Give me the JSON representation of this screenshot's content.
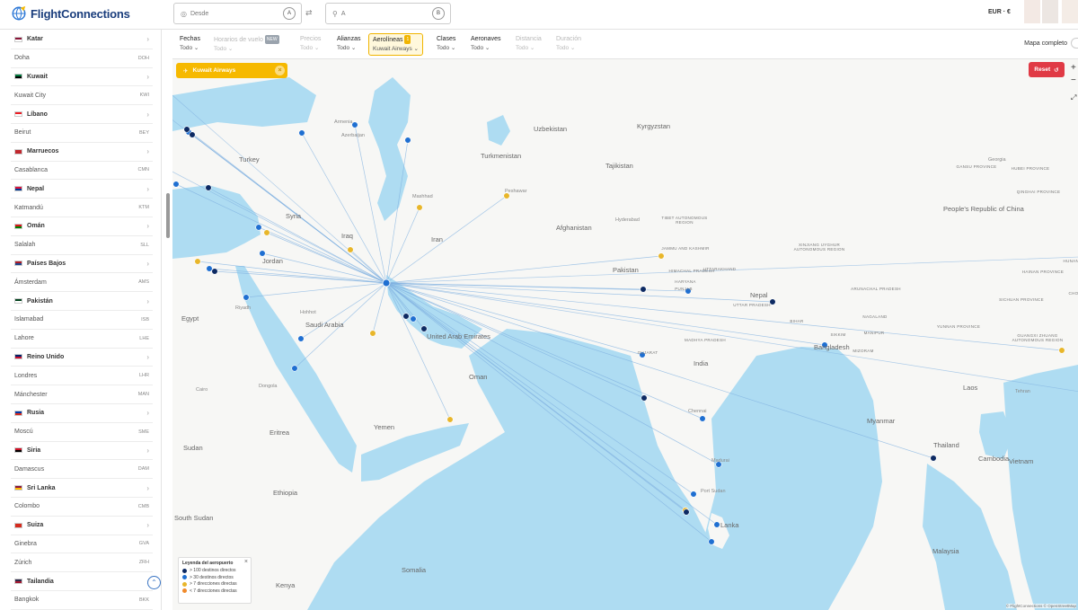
{
  "header": {
    "logo_text": "FlightConnections",
    "from_placeholder": "Desde",
    "from_badge": "A",
    "to_placeholder": "A",
    "to_badge": "B",
    "currency": "EUR · €"
  },
  "sidebar": {
    "rows": [
      {
        "type": "country",
        "name": "Katar",
        "flag": [
          "#8a1538",
          "#fff"
        ]
      },
      {
        "type": "city",
        "name": "Doha",
        "code": "DOH"
      },
      {
        "type": "country",
        "name": "Kuwait",
        "flag": [
          "#007a3d",
          "#000"
        ]
      },
      {
        "type": "city",
        "name": "Kuwait City",
        "code": "KWI"
      },
      {
        "type": "country",
        "name": "Líbano",
        "flag": [
          "#ed1c24",
          "#fff"
        ]
      },
      {
        "type": "city",
        "name": "Beirut",
        "code": "BEY"
      },
      {
        "type": "country",
        "name": "Marruecos",
        "flag": [
          "#c1272d",
          "#c1272d"
        ]
      },
      {
        "type": "city",
        "name": "Casablanca",
        "code": "CMN"
      },
      {
        "type": "country",
        "name": "Nepal",
        "flag": [
          "#dc143c",
          "#003893"
        ]
      },
      {
        "type": "city",
        "name": "Katmandú",
        "code": "KTM"
      },
      {
        "type": "country",
        "name": "Omán",
        "flag": [
          "#db161b",
          "#008000"
        ]
      },
      {
        "type": "city",
        "name": "Salalah",
        "code": "SLL"
      },
      {
        "type": "country",
        "name": "Países Bajos",
        "flag": [
          "#ae1c28",
          "#21468b"
        ]
      },
      {
        "type": "city",
        "name": "Ámsterdam",
        "code": "AMS"
      },
      {
        "type": "country",
        "name": "Pakistán",
        "flag": [
          "#01411c",
          "#fff"
        ]
      },
      {
        "type": "city",
        "name": "Islamabad",
        "code": "ISB"
      },
      {
        "type": "city",
        "name": "Lahore",
        "code": "LHE"
      },
      {
        "type": "country",
        "name": "Reino Unido",
        "flag": [
          "#012169",
          "#c8102e"
        ]
      },
      {
        "type": "city",
        "name": "Londres",
        "code": "LHR"
      },
      {
        "type": "city",
        "name": "Mánchester",
        "code": "MAN"
      },
      {
        "type": "country",
        "name": "Rusia",
        "flag": [
          "#0039a6",
          "#d52b1e"
        ]
      },
      {
        "type": "city",
        "name": "Moscú",
        "code": "SME"
      },
      {
        "type": "country",
        "name": "Siria",
        "flag": [
          "#ce1126",
          "#000"
        ]
      },
      {
        "type": "city",
        "name": "Damascus",
        "code": "DAM"
      },
      {
        "type": "country",
        "name": "Sri Lanka",
        "flag": [
          "#8d153a",
          "#ffb700"
        ]
      },
      {
        "type": "city",
        "name": "Colombo",
        "code": "CMB"
      },
      {
        "type": "country",
        "name": "Suiza",
        "flag": [
          "#d52b1e",
          "#d52b1e"
        ]
      },
      {
        "type": "city",
        "name": "Ginebra",
        "code": "GVA"
      },
      {
        "type": "city",
        "name": "Zúrich",
        "code": "ZRH"
      },
      {
        "type": "country",
        "name": "Tailandia",
        "flag": [
          "#2d2a4a",
          "#a51931"
        ]
      },
      {
        "type": "city",
        "name": "Bangkok",
        "code": "BKK"
      }
    ]
  },
  "filters": [
    {
      "label": "Fechas",
      "value": "Todo ⌄",
      "disabled": false
    },
    {
      "label": "Horarios de vuelo",
      "badge": "NEW",
      "value": "Todo ⌄",
      "disabled": true
    },
    {
      "label": "Precios",
      "value": "Todo ⌄",
      "disabled": true
    },
    {
      "label": "Alianzas",
      "value": "Todo ⌄",
      "disabled": false
    },
    {
      "label": "Aerolíneas",
      "badge": "1",
      "value": "Kuwait Airways ⌄",
      "disabled": false,
      "active": true
    },
    {
      "label": "Clases",
      "value": "Todo ⌄",
      "disabled": false
    },
    {
      "label": "Aeronaves",
      "value": "Todo ⌄",
      "disabled": false
    },
    {
      "label": "Distancia",
      "value": "Todo ⌄",
      "disabled": true
    },
    {
      "label": "Duración",
      "value": "Todo ⌄",
      "disabled": true
    }
  ],
  "mapa_completo": "Mapa completo",
  "map": {
    "airline_chip": "Kuwait Airways",
    "reset_label": "Reset",
    "colors": {
      "water": "#aedcf2",
      "land": "#f7f7f5",
      "route": "#7fb0e0",
      "hub": "#1f6fd1",
      "navy": "#0d2a63",
      "yellow": "#e8b62a",
      "orange": "#f08a2c"
    },
    "labels": [
      {
        "t": "Turkey",
        "c": "country"
      },
      {
        "t": "Syria",
        "c": "country"
      },
      {
        "t": "Iraq",
        "c": "country"
      },
      {
        "t": "Jordan",
        "c": "country"
      },
      {
        "t": "Egypt",
        "c": "country"
      },
      {
        "t": "Saudi Arabia",
        "c": "country"
      },
      {
        "t": "Iran",
        "c": "country"
      },
      {
        "t": "Turkmenistan",
        "c": "country"
      },
      {
        "t": "Uzbekistan",
        "c": "country"
      },
      {
        "t": "Kyrgyzstan",
        "c": "country"
      },
      {
        "t": "Tajikistan",
        "c": "country"
      },
      {
        "t": "Afghanistan",
        "c": "country"
      },
      {
        "t": "Pakistan",
        "c": "country"
      },
      {
        "t": "Nepal",
        "c": "country"
      },
      {
        "t": "India",
        "c": "country"
      },
      {
        "t": "Bangladesh",
        "c": "country"
      },
      {
        "t": "Myanmar",
        "c": "country"
      },
      {
        "t": "Thailand",
        "c": "country"
      },
      {
        "t": "Cambodia",
        "c": "country"
      },
      {
        "t": "Vietnam",
        "c": "country"
      },
      {
        "t": "Laos",
        "c": "country"
      },
      {
        "t": "Malaysia",
        "c": "country"
      },
      {
        "t": "Lanka",
        "c": "country"
      },
      {
        "t": "Oman",
        "c": "country"
      },
      {
        "t": "Yemen",
        "c": "country"
      },
      {
        "t": "Eritrea",
        "c": "country"
      },
      {
        "t": "Ethiopia",
        "c": "country"
      },
      {
        "t": "Sudan",
        "c": "country"
      },
      {
        "t": "South Sudan",
        "c": "country"
      },
      {
        "t": "Kenya",
        "c": "country"
      },
      {
        "t": "Somalia",
        "c": "country"
      },
      {
        "t": "United Arab Emirates",
        "c": "country"
      },
      {
        "t": "People's Republic of China",
        "c": "country"
      },
      {
        "t": "XINJIANG UYGHUR AUTONOMOUS REGION",
        "c": "region"
      },
      {
        "t": "TIBET AUTONOMOUS REGION",
        "c": "region"
      },
      {
        "t": "JAMMU AND KASHMIR",
        "c": "region"
      },
      {
        "t": "HIMACHAL PRADESH",
        "c": "region"
      },
      {
        "t": "PUNJAB",
        "c": "region"
      },
      {
        "t": "UTTARAKHAND",
        "c": "region"
      },
      {
        "t": "HARYANA",
        "c": "region"
      },
      {
        "t": "UTTAR PRADESH",
        "c": "region"
      },
      {
        "t": "BIHAR",
        "c": "region"
      },
      {
        "t": "GUJARAT",
        "c": "region"
      },
      {
        "t": "MADHYA PRADESH",
        "c": "region"
      },
      {
        "t": "ARUNACHAL PRADESH",
        "c": "region"
      },
      {
        "t": "NAGALAND",
        "c": "region"
      },
      {
        "t": "MANIPUR",
        "c": "region"
      },
      {
        "t": "MIZORAM",
        "c": "region"
      },
      {
        "t": "SIKKIM",
        "c": "region"
      },
      {
        "t": "YUNNAN PROVINCE",
        "c": "region"
      },
      {
        "t": "GUANGXI ZHUANG AUTONOMOUS REGION",
        "c": "region"
      },
      {
        "t": "SICHUAN PROVINCE",
        "c": "region"
      },
      {
        "t": "QINGHAI PROVINCE",
        "c": "region"
      },
      {
        "t": "GANSU PROVINCE",
        "c": "region"
      },
      {
        "t": "HUBEI PROVINCE",
        "c": "region"
      },
      {
        "t": "HUNAN PROVINCE",
        "c": "region"
      },
      {
        "t": "CHONGQING",
        "c": "region"
      },
      {
        "t": "HAINAN PROVINCE",
        "c": "region"
      },
      {
        "t": "Tehran",
        "c": "city"
      },
      {
        "t": "Mashhad",
        "c": "city"
      },
      {
        "t": "Peshawar",
        "c": "city"
      },
      {
        "t": "Hyderabad",
        "c": "city"
      },
      {
        "t": "Chennai",
        "c": "city"
      },
      {
        "t": "Madurai",
        "c": "city"
      },
      {
        "t": "Port Sudan",
        "c": "city"
      },
      {
        "t": "Dongola",
        "c": "city"
      },
      {
        "t": "Cairo",
        "c": "city"
      },
      {
        "t": "Riyadh",
        "c": "city"
      },
      {
        "t": "Hohhot",
        "c": "city"
      },
      {
        "t": "Georgia",
        "c": "city"
      },
      {
        "t": "Armenia",
        "c": "city"
      },
      {
        "t": "Azerbaijan",
        "c": "city"
      }
    ],
    "airports": [
      {
        "c": "hub"
      },
      {
        "c": "navy"
      },
      {
        "c": "navy"
      },
      {
        "c": "hub"
      },
      {
        "c": "hub"
      },
      {
        "c": "hub"
      },
      {
        "c": "navy"
      },
      {
        "c": "hub"
      },
      {
        "c": "yellow"
      },
      {
        "c": "yellow"
      },
      {
        "c": "hub"
      },
      {
        "c": "yellow"
      },
      {
        "c": "yellow"
      },
      {
        "c": "navy"
      },
      {
        "c": "hub"
      },
      {
        "c": "yellow"
      },
      {
        "c": "hub"
      },
      {
        "c": "hub"
      },
      {
        "c": "navy"
      },
      {
        "c": "hub"
      },
      {
        "c": "hub"
      },
      {
        "c": "navy"
      },
      {
        "c": "navy"
      },
      {
        "c": "yellow"
      },
      {
        "c": "yellow"
      },
      {
        "c": "hub"
      },
      {
        "c": "yellow"
      },
      {
        "c": "navy"
      },
      {
        "c": "hub"
      },
      {
        "c": "hub"
      },
      {
        "c": "navy"
      },
      {
        "c": "hub"
      },
      {
        "c": "navy"
      },
      {
        "c": "hub"
      },
      {
        "c": "hub"
      },
      {
        "c": "hub"
      },
      {
        "c": "yellow"
      },
      {
        "c": "hub"
      },
      {
        "c": "navy"
      },
      {
        "c": "hub"
      },
      {
        "c": "navy"
      },
      {
        "c": "yellow"
      }
    ],
    "legend": {
      "title": "Leyenda del aeropuerto",
      "items": [
        {
          "label": "> 100 destinos directos",
          "color": "#0d2a63"
        },
        {
          "label": "> 30 destinos directos",
          "color": "#1f6fd1"
        },
        {
          "label": "> 7 direcciones directas",
          "color": "#e8b62a"
        },
        {
          "label": "< 7 direcciones directas",
          "color": "#f08a2c"
        }
      ]
    },
    "attribution": "© FlightConnections © OpenStreetMap"
  }
}
